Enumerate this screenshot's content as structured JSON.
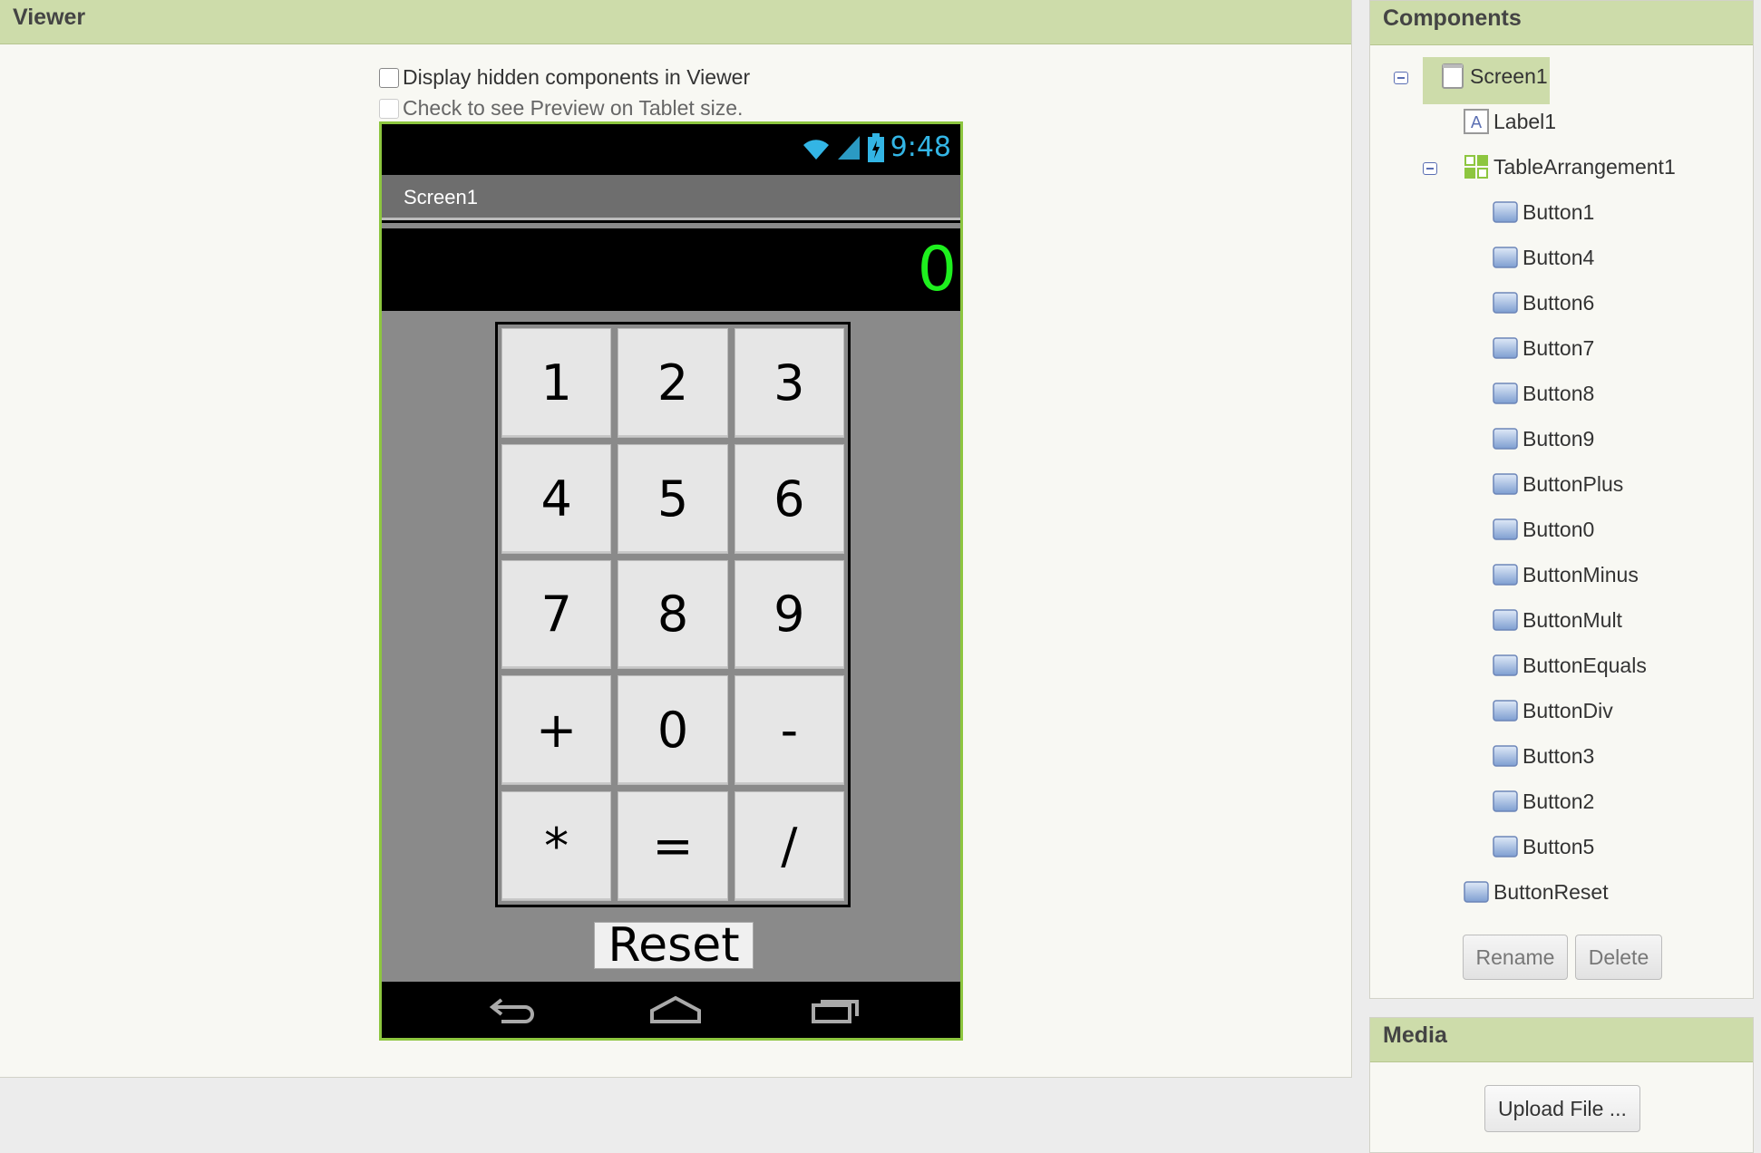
{
  "viewer": {
    "title": "Viewer",
    "option_hidden": "Display hidden components in Viewer",
    "option_tablet": "Check to see Preview on Tablet size."
  },
  "phone": {
    "clock": "9:48",
    "screen_title": "Screen1",
    "display_value": "0",
    "keys": [
      "1",
      "2",
      "3",
      "4",
      "5",
      "6",
      "7",
      "8",
      "9",
      "+",
      "0",
      "-",
      "*",
      "=",
      "/"
    ],
    "reset_label": "Reset"
  },
  "components": {
    "title": "Components",
    "tree": [
      {
        "label": "Screen1",
        "icon": "screen-icon"
      },
      {
        "label": "Label1",
        "icon": "label-icon"
      },
      {
        "label": "TableArrangement1",
        "icon": "table-arrangement-icon"
      },
      {
        "label": "Button1",
        "icon": "button-icon"
      },
      {
        "label": "Button4",
        "icon": "button-icon"
      },
      {
        "label": "Button6",
        "icon": "button-icon"
      },
      {
        "label": "Button7",
        "icon": "button-icon"
      },
      {
        "label": "Button8",
        "icon": "button-icon"
      },
      {
        "label": "Button9",
        "icon": "button-icon"
      },
      {
        "label": "ButtonPlus",
        "icon": "button-icon"
      },
      {
        "label": "Button0",
        "icon": "button-icon"
      },
      {
        "label": "ButtonMinus",
        "icon": "button-icon"
      },
      {
        "label": "ButtonMult",
        "icon": "button-icon"
      },
      {
        "label": "ButtonEquals",
        "icon": "button-icon"
      },
      {
        "label": "ButtonDiv",
        "icon": "button-icon"
      },
      {
        "label": "Button3",
        "icon": "button-icon"
      },
      {
        "label": "Button2",
        "icon": "button-icon"
      },
      {
        "label": "Button5",
        "icon": "button-icon"
      },
      {
        "label": "ButtonReset",
        "icon": "button-icon"
      }
    ],
    "rename_label": "Rename",
    "delete_label": "Delete"
  },
  "media": {
    "title": "Media",
    "upload_label": "Upload File ..."
  },
  "colors": {
    "panel_header": "#cddcaa",
    "phone_border": "#8dc63f",
    "display_text": "#1ef01e",
    "clock": "#33b5e5"
  }
}
